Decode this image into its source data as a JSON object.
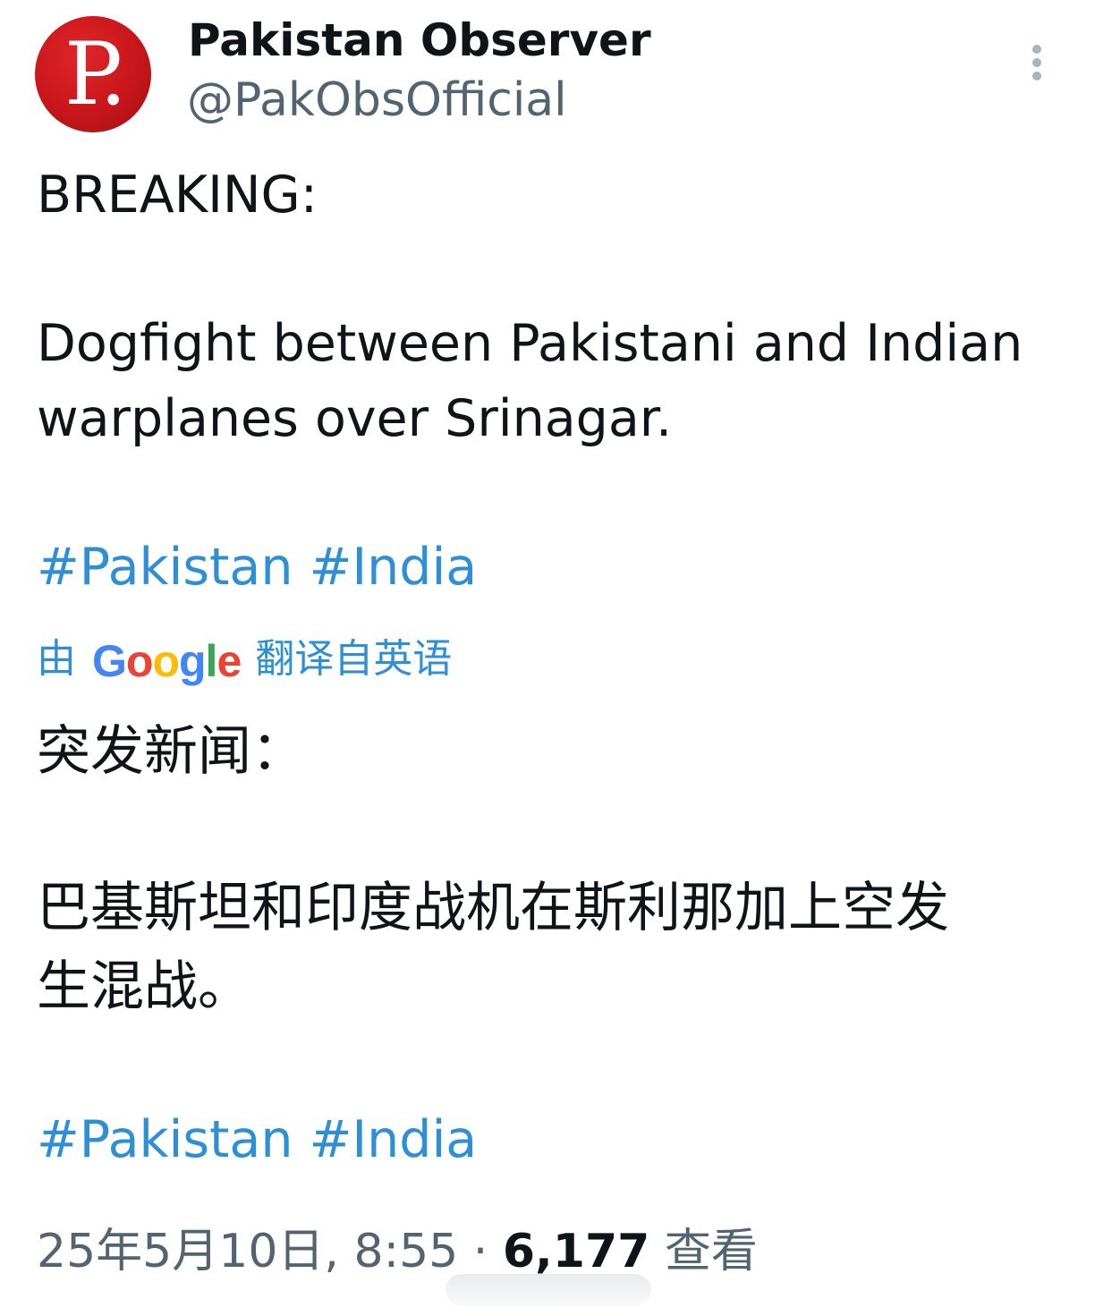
{
  "tweet": {
    "author": {
      "display_name": "Pakistan Observer",
      "handle": "@PakObsOfficial",
      "avatar_letter": "P.",
      "avatar_color": "#c8161b"
    },
    "more_icon": "more-vertical-icon",
    "original": {
      "heading": "BREAKING:",
      "line1": "Dogfight between Pakistani and Indian",
      "line2": "warplanes over Srinagar.",
      "hashtags": [
        "#Pakistan",
        "#India"
      ]
    },
    "translation": {
      "prefix": "由",
      "brand": "Google",
      "suffix": "翻译自英语",
      "heading": "突发新闻：",
      "line1": "巴基斯坦和印度战机在斯利那加上空发",
      "line2": "生混战。",
      "hashtags": [
        "#Pakistan",
        "#India"
      ]
    },
    "meta": {
      "date_time": "25年5月10日, 8:55",
      "separator": " · ",
      "views_count": "6,177",
      "views_label": " 查看"
    },
    "colors": {
      "link": "#2d8fd5",
      "text": "#0f1419",
      "secondary": "#536471"
    }
  }
}
